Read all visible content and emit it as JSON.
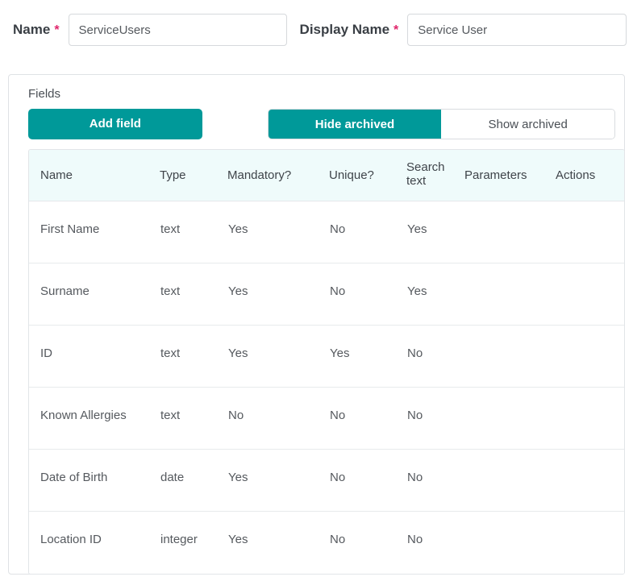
{
  "form": {
    "name": {
      "label": "Name",
      "required_marker": "*",
      "value": "ServiceUsers",
      "placeholder": "Name"
    },
    "display_name": {
      "label": "Display Name",
      "required_marker": "*",
      "value": "Service User",
      "placeholder": "Display Name"
    }
  },
  "fields_card": {
    "title": "Fields",
    "add_field_label": "Add field",
    "hide_archived_label": "Hide archived",
    "show_archived_label": "Show archived",
    "active_toggle": "Hide archived",
    "columns": [
      "Name",
      "Type",
      "Mandatory?",
      "Unique?",
      "Search text",
      "Parameters",
      "Actions"
    ],
    "rows": [
      {
        "name": "First Name",
        "type": "text",
        "mandatory": "Yes",
        "unique": "No",
        "search_text": "Yes",
        "parameters": "",
        "actions": ""
      },
      {
        "name": "Surname",
        "type": "text",
        "mandatory": "Yes",
        "unique": "No",
        "search_text": "Yes",
        "parameters": "",
        "actions": ""
      },
      {
        "name": "ID",
        "type": "text",
        "mandatory": "Yes",
        "unique": "Yes",
        "search_text": "No",
        "parameters": "",
        "actions": ""
      },
      {
        "name": "Known Allergies",
        "type": "text",
        "mandatory": "No",
        "unique": "No",
        "search_text": "No",
        "parameters": "",
        "actions": ""
      },
      {
        "name": "Date of Birth",
        "type": "date",
        "mandatory": "Yes",
        "unique": "No",
        "search_text": "No",
        "parameters": "",
        "actions": ""
      },
      {
        "name": "Location ID",
        "type": "integer",
        "mandatory": "Yes",
        "unique": "No",
        "search_text": "No",
        "parameters": "",
        "actions": ""
      }
    ]
  },
  "colors": {
    "accent_teal": "#009999",
    "required_star": "#e0256b",
    "table_header_bg": "#effbfb"
  }
}
